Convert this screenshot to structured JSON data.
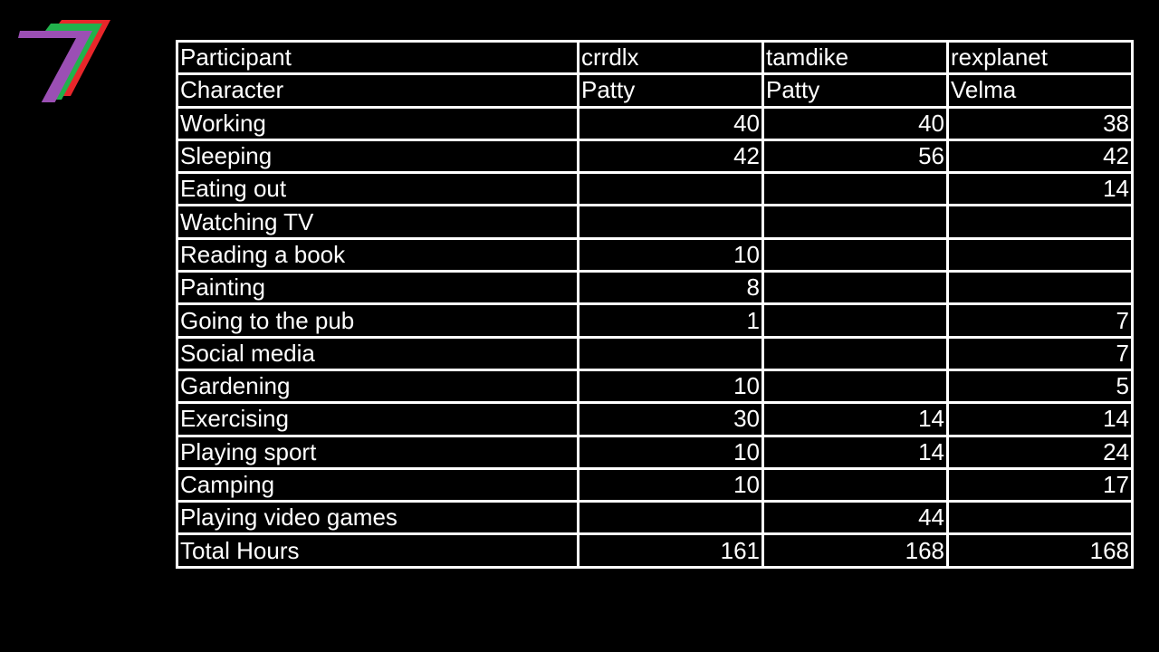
{
  "logo": {
    "name": "channel-7-logo",
    "colors": [
      "#9b4fb4",
      "#22b14c",
      "#e8262a"
    ]
  },
  "table": {
    "header_rows": [
      {
        "label": "Participant",
        "values": [
          "crrdlx",
          "tamdike",
          "rexplanet"
        ]
      },
      {
        "label": "Character",
        "values": [
          "Patty",
          "Patty",
          "Velma"
        ]
      }
    ],
    "rows": [
      {
        "label": "Working",
        "values": [
          "40",
          "40",
          "38"
        ]
      },
      {
        "label": "Sleeping",
        "values": [
          "42",
          "56",
          "42"
        ]
      },
      {
        "label": "Eating out",
        "values": [
          "",
          "",
          "14"
        ]
      },
      {
        "label": "Watching TV",
        "values": [
          "",
          "",
          ""
        ]
      },
      {
        "label": "Reading a book",
        "values": [
          "10",
          "",
          ""
        ]
      },
      {
        "label": "Painting",
        "values": [
          "8",
          "",
          ""
        ]
      },
      {
        "label": "Going to the pub",
        "values": [
          "1",
          "",
          "7"
        ]
      },
      {
        "label": "Social media",
        "values": [
          "",
          "",
          "7"
        ]
      },
      {
        "label": "Gardening",
        "values": [
          "10",
          "",
          "5"
        ]
      },
      {
        "label": "Exercising",
        "values": [
          "30",
          "14",
          "14"
        ]
      },
      {
        "label": "Playing sport",
        "values": [
          "10",
          "14",
          "24"
        ]
      },
      {
        "label": "Camping",
        "values": [
          "10",
          "",
          "17"
        ]
      },
      {
        "label": "Playing video games",
        "values": [
          "",
          "44",
          ""
        ]
      },
      {
        "label": "Total Hours",
        "values": [
          "161",
          "168",
          "168"
        ]
      }
    ]
  }
}
